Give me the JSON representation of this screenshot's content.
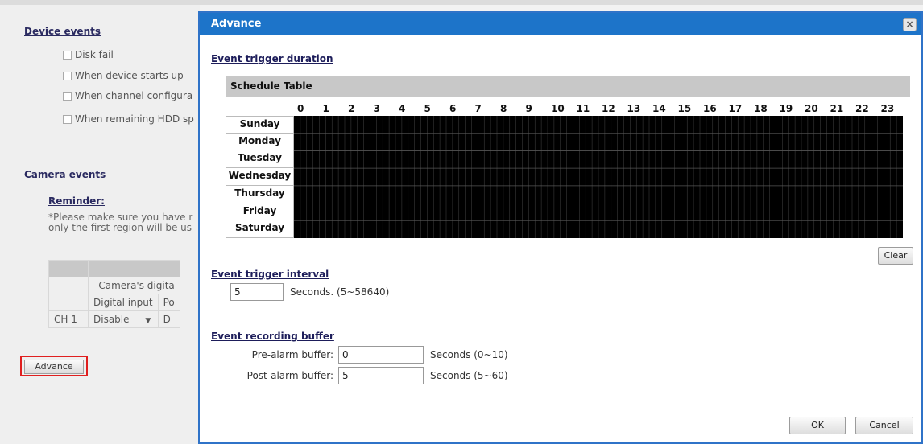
{
  "background": {
    "device_events": {
      "title": "Device events",
      "items": [
        "Disk fail",
        "When device starts up",
        "When channel configura",
        "When remaining HDD sp"
      ]
    },
    "camera_events": {
      "title": "Camera events",
      "reminder_title": "Reminder:",
      "reminder_text": "*Please make sure you have r\nonly the first region will be us"
    },
    "table": {
      "group_header": "Camera's digita",
      "col_digital_input": "Digital input",
      "col_po": "Po",
      "row_label": "CH 1",
      "row_value": "Disable",
      "row_value2": "D"
    },
    "advance_button": "Advance"
  },
  "modal": {
    "title": "Advance",
    "close_glyph": "×",
    "trigger_duration_title": "Event trigger duration",
    "schedule": {
      "header": "Schedule Table",
      "hours": [
        "0",
        "1",
        "2",
        "3",
        "4",
        "5",
        "6",
        "7",
        "8",
        "9",
        "10",
        "11",
        "12",
        "13",
        "14",
        "15",
        "16",
        "17",
        "18",
        "19",
        "20",
        "21",
        "22",
        "23"
      ],
      "days": [
        "Sunday",
        "Monday",
        "Tuesday",
        "Wednesday",
        "Thursday",
        "Friday",
        "Saturday"
      ],
      "grid_color": "#000000"
    },
    "clear_button": "Clear",
    "interval": {
      "title": "Event trigger interval",
      "value": "5",
      "hint": "Seconds. (5~58640)"
    },
    "buffer": {
      "title": "Event recording buffer",
      "pre_label": "Pre-alarm buffer:",
      "pre_value": "0",
      "pre_hint": "Seconds (0~10)",
      "post_label": "Post-alarm buffer:",
      "post_value": "5",
      "post_hint": "Seconds (5~60)"
    },
    "ok_button": "OK",
    "cancel_button": "Cancel"
  },
  "colors": {
    "title_bar": "#1d74c9",
    "highlight_border": "#e01f1f"
  }
}
